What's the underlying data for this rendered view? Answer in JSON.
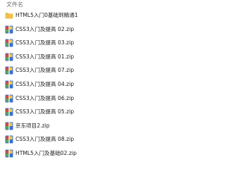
{
  "header": {
    "column_name": "文件名"
  },
  "files": [
    {
      "name": "HTML5入门0基础到精通1",
      "icon": "folder-icon"
    },
    {
      "name": "CSS3入门及提高 02.zip",
      "icon": "zip-archive-icon"
    },
    {
      "name": "CSS3入门及提高 03.zip",
      "icon": "zip-archive-icon"
    },
    {
      "name": "CSS3入门及提高 01.zip",
      "icon": "zip-archive-icon"
    },
    {
      "name": "CSS3入门及提高 07.zip",
      "icon": "zip-archive-icon"
    },
    {
      "name": "CSS3入门及提高 04.zip",
      "icon": "zip-archive-icon"
    },
    {
      "name": "CSS3入门及提高 06.zip",
      "icon": "zip-archive-icon"
    },
    {
      "name": "CSS3入门及提高 05.zip",
      "icon": "zip-archive-icon"
    },
    {
      "name": "京东项目2.zip",
      "icon": "zip-archive-icon"
    },
    {
      "name": "CSS3入门及提高 08.zip",
      "icon": "zip-archive-icon"
    },
    {
      "name": "HTML5入门及基础02.zip",
      "icon": "zip-archive-icon"
    }
  ],
  "colors": {
    "folder": "#f0c24a",
    "folder_tab": "#e3ad2c",
    "zip_blue": "#3a6fd1",
    "zip_red": "#d84a3a",
    "zip_yellow": "#f2c94c",
    "zip_green": "#5aa84a"
  }
}
